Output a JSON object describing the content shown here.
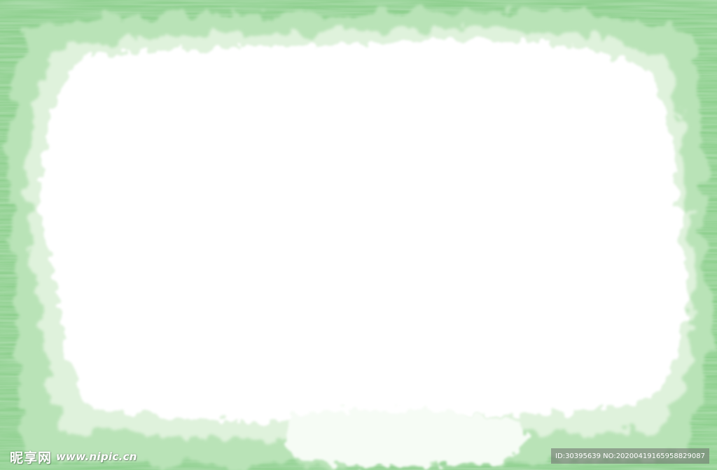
{
  "frame": {
    "edge_color": "#8fd08f",
    "mid_color": "#b9e3b7",
    "light_color": "#dff2dc",
    "center_color": "#ffffff"
  },
  "watermark": {
    "brand": "昵享网",
    "site": "www.nipic.cn"
  },
  "id_strip": {
    "text": "ID:30395639 NO:20200419165958829087"
  }
}
